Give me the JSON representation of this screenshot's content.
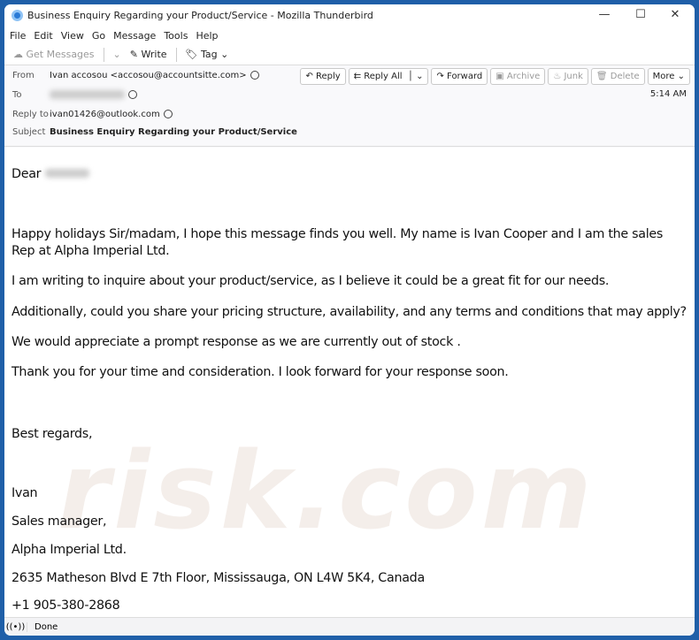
{
  "window": {
    "title": "Business Enquiry Regarding your Product/Service - Mozilla Thunderbird"
  },
  "menu": [
    "File",
    "Edit",
    "View",
    "Go",
    "Message",
    "Tools",
    "Help"
  ],
  "toolbar": {
    "get_messages": "Get Messages",
    "write": "Write",
    "tag": "Tag"
  },
  "header": {
    "from_label": "From",
    "from": "Ivan accosou <accosou@accountsitte.com>",
    "to_label": "To",
    "reply_to_label": "Reply to",
    "reply_to": "ivan01426@outlook.com",
    "subject_label": "Subject",
    "subject": "Business Enquiry Regarding your Product/Service",
    "time": "5:14 AM",
    "buttons": {
      "reply": "Reply",
      "reply_all": "Reply All",
      "forward": "Forward",
      "archive": "Archive",
      "junk": "Junk",
      "delete": "Delete",
      "more": "More"
    }
  },
  "body": {
    "greeting": "Dear",
    "p1": "Happy holidays Sir/madam, I hope this message finds you well. My name is Ivan Cooper and I am the sales Rep at Alpha Imperial Ltd.",
    "p2": " I am writing to inquire about your product/service, as I believe it could be a great fit for our needs.",
    "p3": "Additionally, could you share your pricing structure, availability, and any terms and conditions that may apply?",
    "p4": " We would appreciate a prompt response as we are currently out of stock .",
    "p5": "Thank you for your time and consideration. I look forward for your response soon.",
    "closing": "Best regards,",
    "sig_name": "Ivan",
    "sig_title": "Sales manager,",
    "sig_company": "Alpha Imperial Ltd.",
    "sig_address": "2635 Matheson Blvd E 7th Floor, Mississauga, ON L4W 5K4, Canada",
    "sig_phone": "+1 905-380-2868"
  },
  "status": {
    "text": "Done"
  },
  "watermark": "risk.com"
}
